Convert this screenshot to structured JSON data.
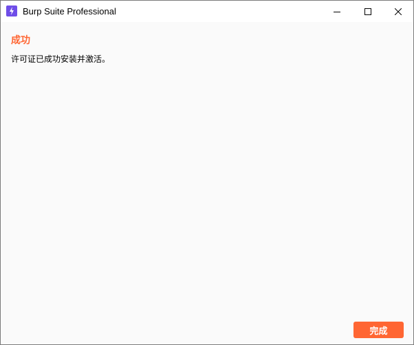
{
  "window": {
    "title": "Burp Suite Professional",
    "icon": "burp-suite-lightning-icon",
    "controls": [
      "minimize-icon",
      "maximize-icon",
      "close-icon"
    ]
  },
  "dialog": {
    "heading": "成功",
    "message": "许可证已成功安装并激活。",
    "done_label": "完成"
  },
  "colors": {
    "accent": "#ff6633",
    "icon_bg": "#6f4ee8",
    "content_bg": "#fafafa"
  }
}
